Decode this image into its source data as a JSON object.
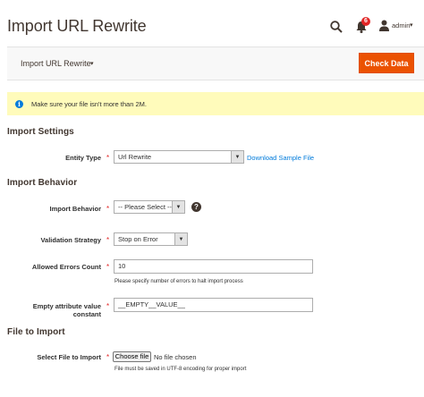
{
  "header": {
    "title": "Import URL Rewrite",
    "notifications_count": "6",
    "user_name": "admin",
    "caret": "▾"
  },
  "toolbar": {
    "breadcrumb": "Import URL Rewrite",
    "breadcrumb_caret": "▾",
    "check_button": "Check Data"
  },
  "notice": {
    "icon_glyph": "i",
    "text": "Make sure your file isn't more than 2M."
  },
  "import_settings": {
    "title": "Import Settings",
    "entity_type_label": "Entity Type",
    "entity_type_value": "Url Rewrite",
    "download_link": "Download Sample File"
  },
  "import_behavior": {
    "title": "Import Behavior",
    "behavior_label": "Import Behavior",
    "behavior_value": "-- Please Select --",
    "help_glyph": "?",
    "validation_label": "Validation Strategy",
    "validation_value": "Stop on Error",
    "errors_label": "Allowed Errors Count",
    "errors_value": "10",
    "errors_note": "Please specify number of errors to halt import process",
    "empty_label": "Empty attribute value constant",
    "empty_value": "__EMPTY__VALUE__"
  },
  "file_to_import": {
    "title": "File to Import",
    "select_label": "Select File to Import",
    "choose_button": "Choose file",
    "file_status": "No file chosen",
    "file_note": "File must be saved in UTF-8 encoding for proper import"
  },
  "required_mark": "*",
  "select_arrow": "▼",
  "colors": {
    "accent": "#eb5202",
    "link": "#007bdb",
    "notice_bg": "#fffbbb",
    "required": "#e22626"
  },
  "icons": [
    "search-icon",
    "bell-icon",
    "user-icon",
    "info-icon",
    "help-icon",
    "chevron-down-icon"
  ]
}
